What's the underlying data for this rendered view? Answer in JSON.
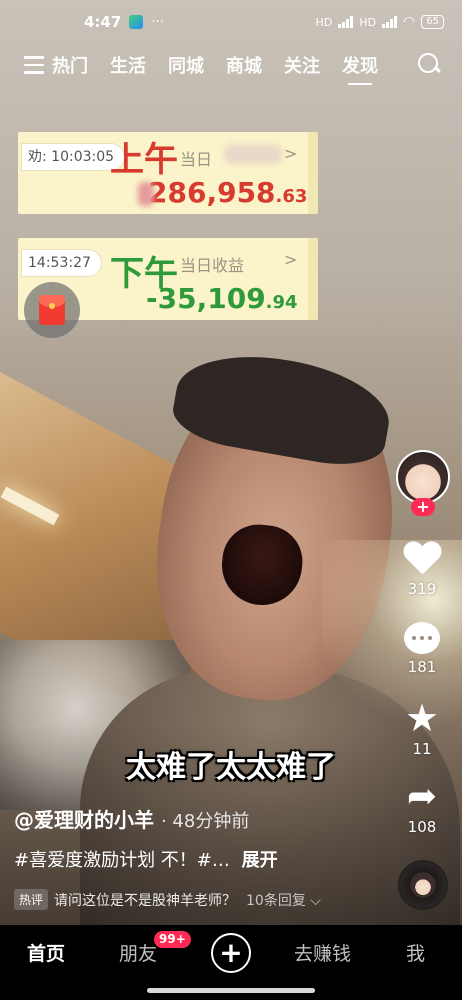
{
  "status_bar": {
    "time": "4:47",
    "dots": "···",
    "network_label_1": "HD",
    "network_label_2": "HD",
    "battery": "65"
  },
  "top_nav": {
    "tabs": [
      {
        "label": "热门"
      },
      {
        "label": "生活"
      },
      {
        "label": "同城"
      },
      {
        "label": "商城"
      },
      {
        "label": "关注"
      },
      {
        "label": "发现",
        "active": true
      }
    ],
    "menu_icon": "hamburger-icon",
    "search_icon": "search-icon"
  },
  "cards": {
    "am": {
      "time": "10:03:05",
      "time_prefix": "劝:",
      "period": "上午",
      "label": "当日",
      "chevron": ">",
      "amount_main": "286,958",
      "amount_decimal": ".63"
    },
    "pm": {
      "time": "14:53:27",
      "period": "下午",
      "label": "当日收益",
      "chevron": ">",
      "amount_main": "-35,109",
      "amount_decimal": ".94"
    }
  },
  "sidebar": {
    "follow": "+",
    "likes": "319",
    "comments": "181",
    "favorites": "11",
    "shares": "108"
  },
  "caption": "太难了太太难了",
  "post": {
    "author": "@爱理财的小羊",
    "time_ago": "· 48分钟前",
    "description": "#喜爱度激励计划 不！#…",
    "expand": "展开",
    "hot_tag": "热评",
    "hot_comment": "请问这位是不是股神羊老师？",
    "replies": "10条回复"
  },
  "bottom_nav": {
    "home": "首页",
    "friends": "朋友",
    "friends_badge": "99+",
    "plus": "+",
    "earn": "去赚钱",
    "me": "我"
  },
  "colors": {
    "accent_red": "#fe2c55",
    "gain_red": "#d73a2e",
    "loss_green": "#2f9a3b",
    "card_bg": "#fbf3c9"
  }
}
